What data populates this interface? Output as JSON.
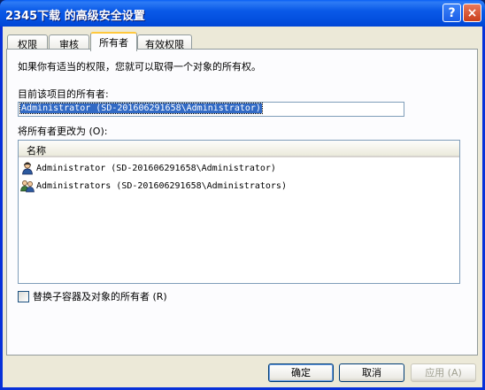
{
  "window": {
    "title": "2345下载 的高级安全设置",
    "help_glyph": "?",
    "close_glyph": "×"
  },
  "tabs": [
    {
      "label": "权限"
    },
    {
      "label": "审核"
    },
    {
      "label": "所有者",
      "active": true
    },
    {
      "label": "有效权限"
    }
  ],
  "owner_tab": {
    "description": "如果你有适当的权限，您就可以取得一个对象的所有权。",
    "current_owner_label": "目前该项目的所有者:",
    "current_owner_value": "Administrator (SD-201606291658\\Administrator)",
    "change_owner_label": "将所有者更改为 (O):",
    "list_header": "名称",
    "owners": [
      {
        "name": "Administrator (SD-201606291658\\Administrator)",
        "icon": "user-icon"
      },
      {
        "name": "Administrators (SD-201606291658\\Administrators)",
        "icon": "group-icon"
      }
    ],
    "replace_checkbox_label": "替换子容器及对象的所有者 (R)",
    "replace_checked": false
  },
  "buttons": {
    "ok": "确定",
    "cancel": "取消",
    "apply": "应用 (A)"
  },
  "colors": {
    "title_bar": "#0a5ae8",
    "selection": "#316ac5",
    "dialog_bg": "#ece9d8",
    "active_tab_accent": "#ffc83c"
  }
}
